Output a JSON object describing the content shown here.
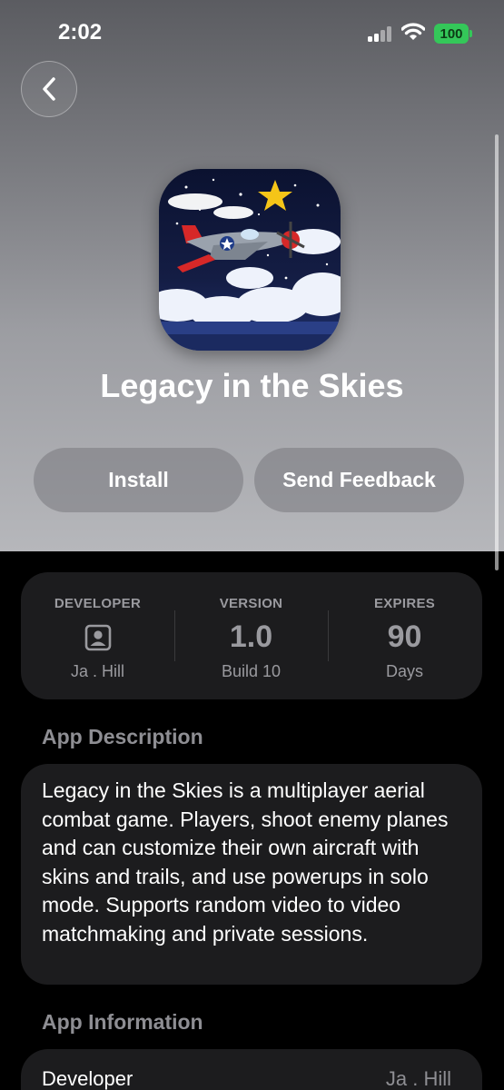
{
  "status_bar": {
    "time": "2:02",
    "battery": "100"
  },
  "app": {
    "name": "Legacy in the Skies"
  },
  "actions": {
    "install_label": "Install",
    "feedback_label": "Send Feedback"
  },
  "info": {
    "developer": {
      "label": "DEVELOPER",
      "value": "Ja . Hill",
      "icon": "person-square-icon"
    },
    "version": {
      "label": "VERSION",
      "value": "1.0",
      "sub": "Build 10"
    },
    "expires": {
      "label": "EXPIRES",
      "value": "90",
      "sub": "Days"
    }
  },
  "description": {
    "heading": "App Description",
    "text": "Legacy in the Skies is a multiplayer aerial combat game. Players, shoot enemy planes and can customize their own aircraft with skins and trails, and use powerups in solo mode. Supports random video to video matchmaking and private sessions."
  },
  "app_information": {
    "heading": "App Information",
    "rows": [
      {
        "label": "Developer",
        "value": "Ja . Hill"
      }
    ]
  },
  "colors": {
    "battery": "#34c759",
    "card": "#1c1c1e",
    "secondary_text": "#8e8e93"
  }
}
